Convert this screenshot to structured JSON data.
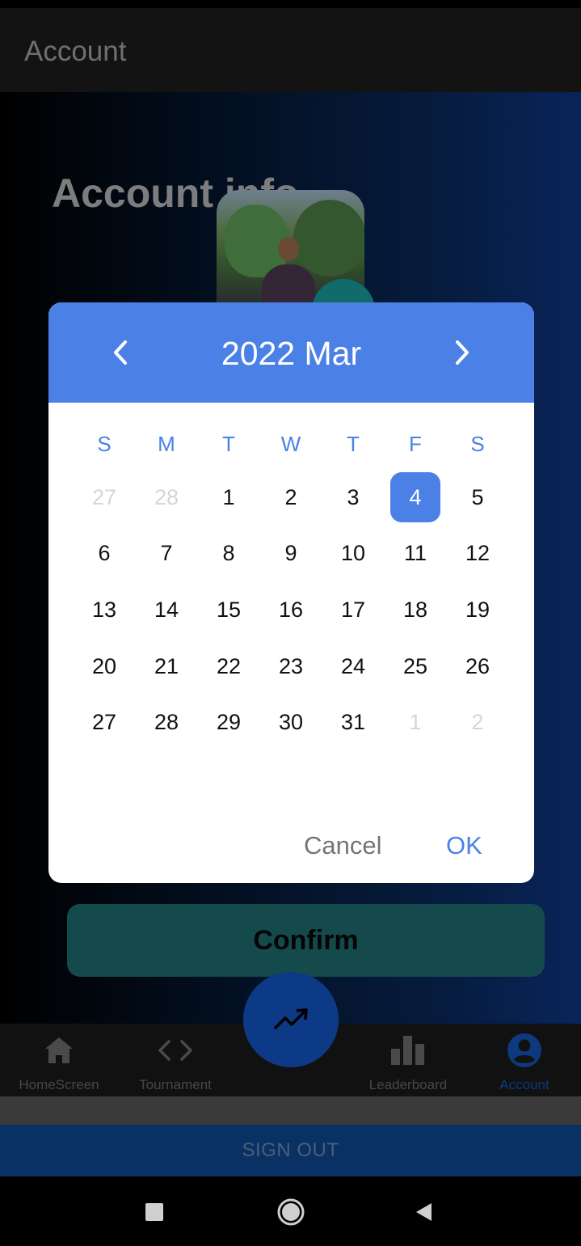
{
  "app_bar": {
    "title": "Account"
  },
  "page": {
    "section_title": "Account info",
    "confirm_label": "Confirm"
  },
  "bottom_nav": {
    "items": [
      {
        "label": "HomeScreen",
        "icon": "home-icon"
      },
      {
        "label": "Tournament",
        "icon": "code-icon"
      },
      {
        "label": "Leaderboard",
        "icon": "bar-chart-icon"
      },
      {
        "label": "Account",
        "icon": "account-circle-icon",
        "active": true
      }
    ],
    "fab_icon": "trending-up-icon"
  },
  "sign_out_label": "SIGN OUT",
  "date_picker": {
    "title": "2022 Mar",
    "weekdays": [
      "S",
      "M",
      "T",
      "W",
      "T",
      "F",
      "S"
    ],
    "weeks": [
      [
        "27",
        "28",
        "1",
        "2",
        "3",
        "4",
        "5"
      ],
      [
        "6",
        "7",
        "8",
        "9",
        "10",
        "11",
        "12"
      ],
      [
        "13",
        "14",
        "15",
        "16",
        "17",
        "18",
        "19"
      ],
      [
        "20",
        "21",
        "22",
        "23",
        "24",
        "25",
        "26"
      ],
      [
        "27",
        "28",
        "29",
        "30",
        "31",
        "1",
        "2"
      ]
    ],
    "muted_days": [
      [
        0,
        0
      ],
      [
        0,
        1
      ],
      [
        4,
        5
      ],
      [
        4,
        6
      ]
    ],
    "selected_day": "4",
    "cancel_label": "Cancel",
    "ok_label": "OK"
  },
  "colors": {
    "accent": "#4b81e6",
    "app_bar": "#131313",
    "confirm_bg": "#154a4d",
    "nav_active": "#0d3a7e",
    "sign_out_bg": "#0a3163"
  }
}
